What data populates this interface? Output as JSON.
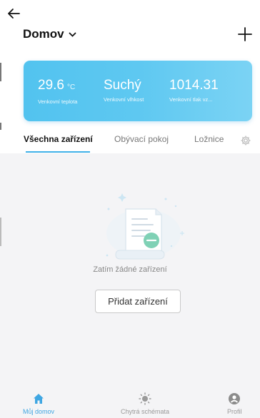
{
  "header": {
    "home_name": "Domov"
  },
  "weather": {
    "temperature": {
      "value": "29.6",
      "unit": "°C",
      "label": "Venkovní teplota"
    },
    "humidity": {
      "value": "Suchý",
      "label": "Venkovní vlhkost"
    },
    "pressure": {
      "value": "1014.31",
      "label": "Venkovní tlak vz..."
    }
  },
  "tabs": [
    {
      "label": "Všechna zařízení",
      "active": true
    },
    {
      "label": "Obývací pokoj",
      "active": false
    },
    {
      "label": "Ložnice",
      "active": false
    }
  ],
  "empty_state": {
    "text": "Zatím žádné zařízení",
    "button_label": "Přidat zařízení"
  },
  "bottom_nav": [
    {
      "label": "Můj domov",
      "icon": "home-icon",
      "active": true
    },
    {
      "label": "Chytrá schémata",
      "icon": "sun-icon",
      "active": false
    },
    {
      "label": "Profil",
      "icon": "profile-icon",
      "active": false
    }
  ],
  "colors": {
    "accent": "#3fa6e2",
    "weather_card": "#5ec8f1",
    "background": "#f4f4f6"
  }
}
